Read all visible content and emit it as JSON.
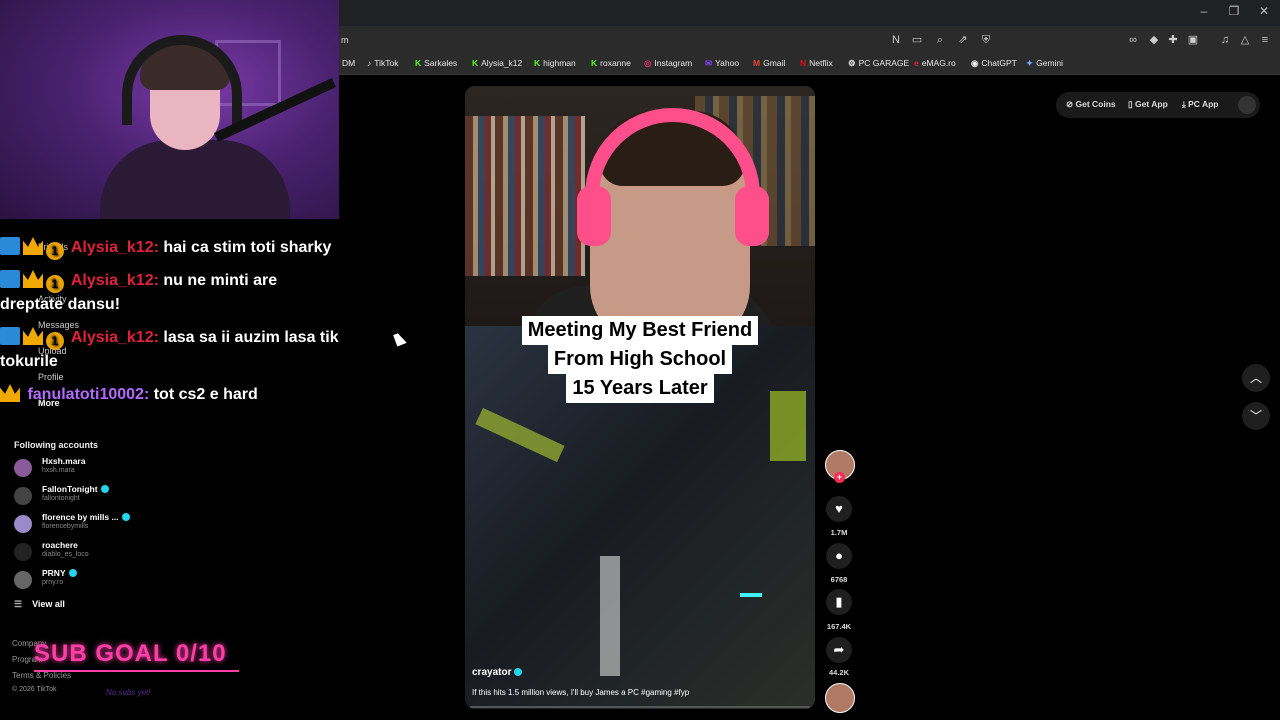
{
  "browser": {
    "url_fragment": "m",
    "window_controls": [
      "–",
      "❐",
      "✕"
    ],
    "bookmarks": [
      {
        "label": "DM",
        "icon": ""
      },
      {
        "label": "TikTok",
        "icon": "♪"
      },
      {
        "label": "Sarkales",
        "icon": "K"
      },
      {
        "label": "Alysia_k12",
        "icon": "K"
      },
      {
        "label": "highman",
        "icon": "K"
      },
      {
        "label": "roxanne",
        "icon": "K"
      },
      {
        "label": "Instagram",
        "icon": "◎"
      },
      {
        "label": "Yahoo",
        "icon": "✉"
      },
      {
        "label": "Gmail",
        "icon": "M"
      },
      {
        "label": "Netflix",
        "icon": "N"
      },
      {
        "label": "PC GARAGE",
        "icon": "⚙"
      },
      {
        "label": "eMAG.ro",
        "icon": "e"
      },
      {
        "label": "ChatGPT",
        "icon": "◉"
      },
      {
        "label": "Gemini",
        "icon": "✦"
      }
    ]
  },
  "topbar": {
    "get_coins": "Get Coins",
    "get_app": "Get App",
    "pc_app": "PC App"
  },
  "sidebar": {
    "nav_items": [
      "Friends",
      "Activity",
      "Messages",
      "Upload",
      "Profile"
    ],
    "more": "More",
    "following_title": "Following accounts",
    "accounts": [
      {
        "name": "Hxsh.mara",
        "handle": "hxsh.mara",
        "verified": false,
        "color": "#8a5a9a"
      },
      {
        "name": "FallonTonight",
        "handle": "fallontonight",
        "verified": true,
        "color": "#444"
      },
      {
        "name": "florence by mills ...",
        "handle": "florencebymills",
        "verified": true,
        "color": "#9a8ac8"
      },
      {
        "name": "roachere",
        "handle": "diablo_es_loco",
        "verified": false,
        "color": "#222"
      },
      {
        "name": "PRNY",
        "handle": "prny.ro",
        "verified": true,
        "color": "#666"
      }
    ],
    "view_all": "View all",
    "footer": {
      "company": "Company",
      "program": "Program",
      "terms": "Terms & Policies",
      "copyright": "© 2026 TikTok"
    }
  },
  "video": {
    "caption_lines": [
      "Meeting My Best Friend",
      "From High School",
      "15 Years Later"
    ],
    "creator": "crayator",
    "description": "If this hits 1.5 million views, I'll buy James a PC #gaming #fyp"
  },
  "actions": {
    "likes": "1.7M",
    "comments": "6768",
    "saves": "167.4K",
    "shares": "44.2K"
  },
  "stream_overlay": {
    "chat": [
      {
        "user": "Alysia_k12:",
        "message": "hai ca stim toti sharky",
        "user_color": "red",
        "badges": [
          "sword",
          "crown",
          "one"
        ]
      },
      {
        "user": "Alysia_k12:",
        "message": "nu ne minti are dreptate dansu!",
        "user_color": "red",
        "badges": [
          "sword",
          "crown",
          "one"
        ]
      },
      {
        "user": "Alysia_k12:",
        "message": "lasa sa ii auzim lasa tik tokurile",
        "user_color": "red",
        "badges": [
          "sword",
          "crown",
          "one"
        ]
      },
      {
        "user": "fanulatoti10002:",
        "message": "tot cs2 e hard",
        "user_color": "purple",
        "badges": [
          "crown"
        ]
      }
    ],
    "badge_one_text": "1",
    "sub_goal": "SUB GOAL 0/10",
    "no_subs": "No subs yet!"
  },
  "colors": {
    "tiktok_red": "#fe2c55",
    "verified": "#20d5ec",
    "sub_goal": "#ff3ea8",
    "chat_red_user": "#e0223a",
    "chat_purple_user": "#b36bff"
  }
}
